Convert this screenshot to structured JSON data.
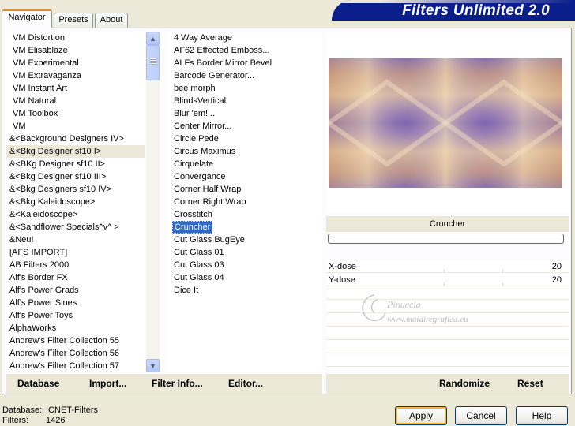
{
  "tabs": [
    {
      "label": "Navigator",
      "active": true
    },
    {
      "label": "Presets",
      "active": false
    },
    {
      "label": "About",
      "active": false
    }
  ],
  "banner": {
    "title": "Filters Unlimited 2.0"
  },
  "categories": [
    "VM Distortion",
    "VM Elisablaze",
    "VM Experimental",
    "VM Extravaganza",
    "VM Instant Art",
    "VM Natural",
    "VM Toolbox",
    "VM",
    "&<Background Designers IV>",
    "&<Bkg Designer sf10 I>",
    "&<BKg Designer sf10 II>",
    "&<Bkg Designer sf10 III>",
    "&<Bkg Designers sf10 IV>",
    "&<Bkg Kaleidoscope>",
    "&<Kaleidoscope>",
    "&<Sandflower Specials^v^ >",
    "&Neu!",
    "[AFS IMPORT]",
    "AB Filters 2000",
    "Alf's Border FX",
    "Alf's Power Grads",
    "Alf's Power Sines",
    "Alf's Power Toys",
    "AlphaWorks",
    "Andrew's Filter Collection 55",
    "Andrew's Filter Collection 56",
    "Andrew's Filter Collection 57"
  ],
  "selected_category_index": 9,
  "filters": [
    "4 Way Average",
    "AF62 Effected Emboss...",
    "ALFs Border Mirror Bevel",
    "Barcode Generator...",
    "bee morph",
    "BlindsVertical",
    "Blur 'em!...",
    "Center Mirror...",
    "Circle Pede",
    "Circus Maximus",
    "Cirquelate",
    "Convergance",
    "Corner Half Wrap",
    "Corner Right Wrap",
    "Crosstitch",
    "Cruncher",
    "Cut Glass  BugEye",
    "Cut Glass 01",
    "Cut Glass 03",
    "Cut Glass 04",
    "Dice It"
  ],
  "selected_filter_index": 15,
  "preview": {
    "filter_name": "Cruncher"
  },
  "params": [
    {
      "label": "X-dose",
      "value": "20"
    },
    {
      "label": "Y-dose",
      "value": "20"
    }
  ],
  "watermark": {
    "line1": "Pinuccia",
    "line2": "www.maidiregrafica.eu"
  },
  "bottom_links": {
    "database": "Database",
    "import": "Import...",
    "filter_info": "Filter Info...",
    "editor": "Editor...",
    "randomize": "Randomize",
    "reset": "Reset"
  },
  "status": {
    "database_label": "Database:",
    "database_value": "ICNET-Filters",
    "filters_label": "Filters:",
    "filters_value": "1426"
  },
  "buttons": {
    "apply": "Apply",
    "cancel": "Cancel",
    "help": "Help"
  },
  "colors": {
    "selection": "#316ac5",
    "banner": "#0a1e8c",
    "face": "#ece9d8"
  }
}
